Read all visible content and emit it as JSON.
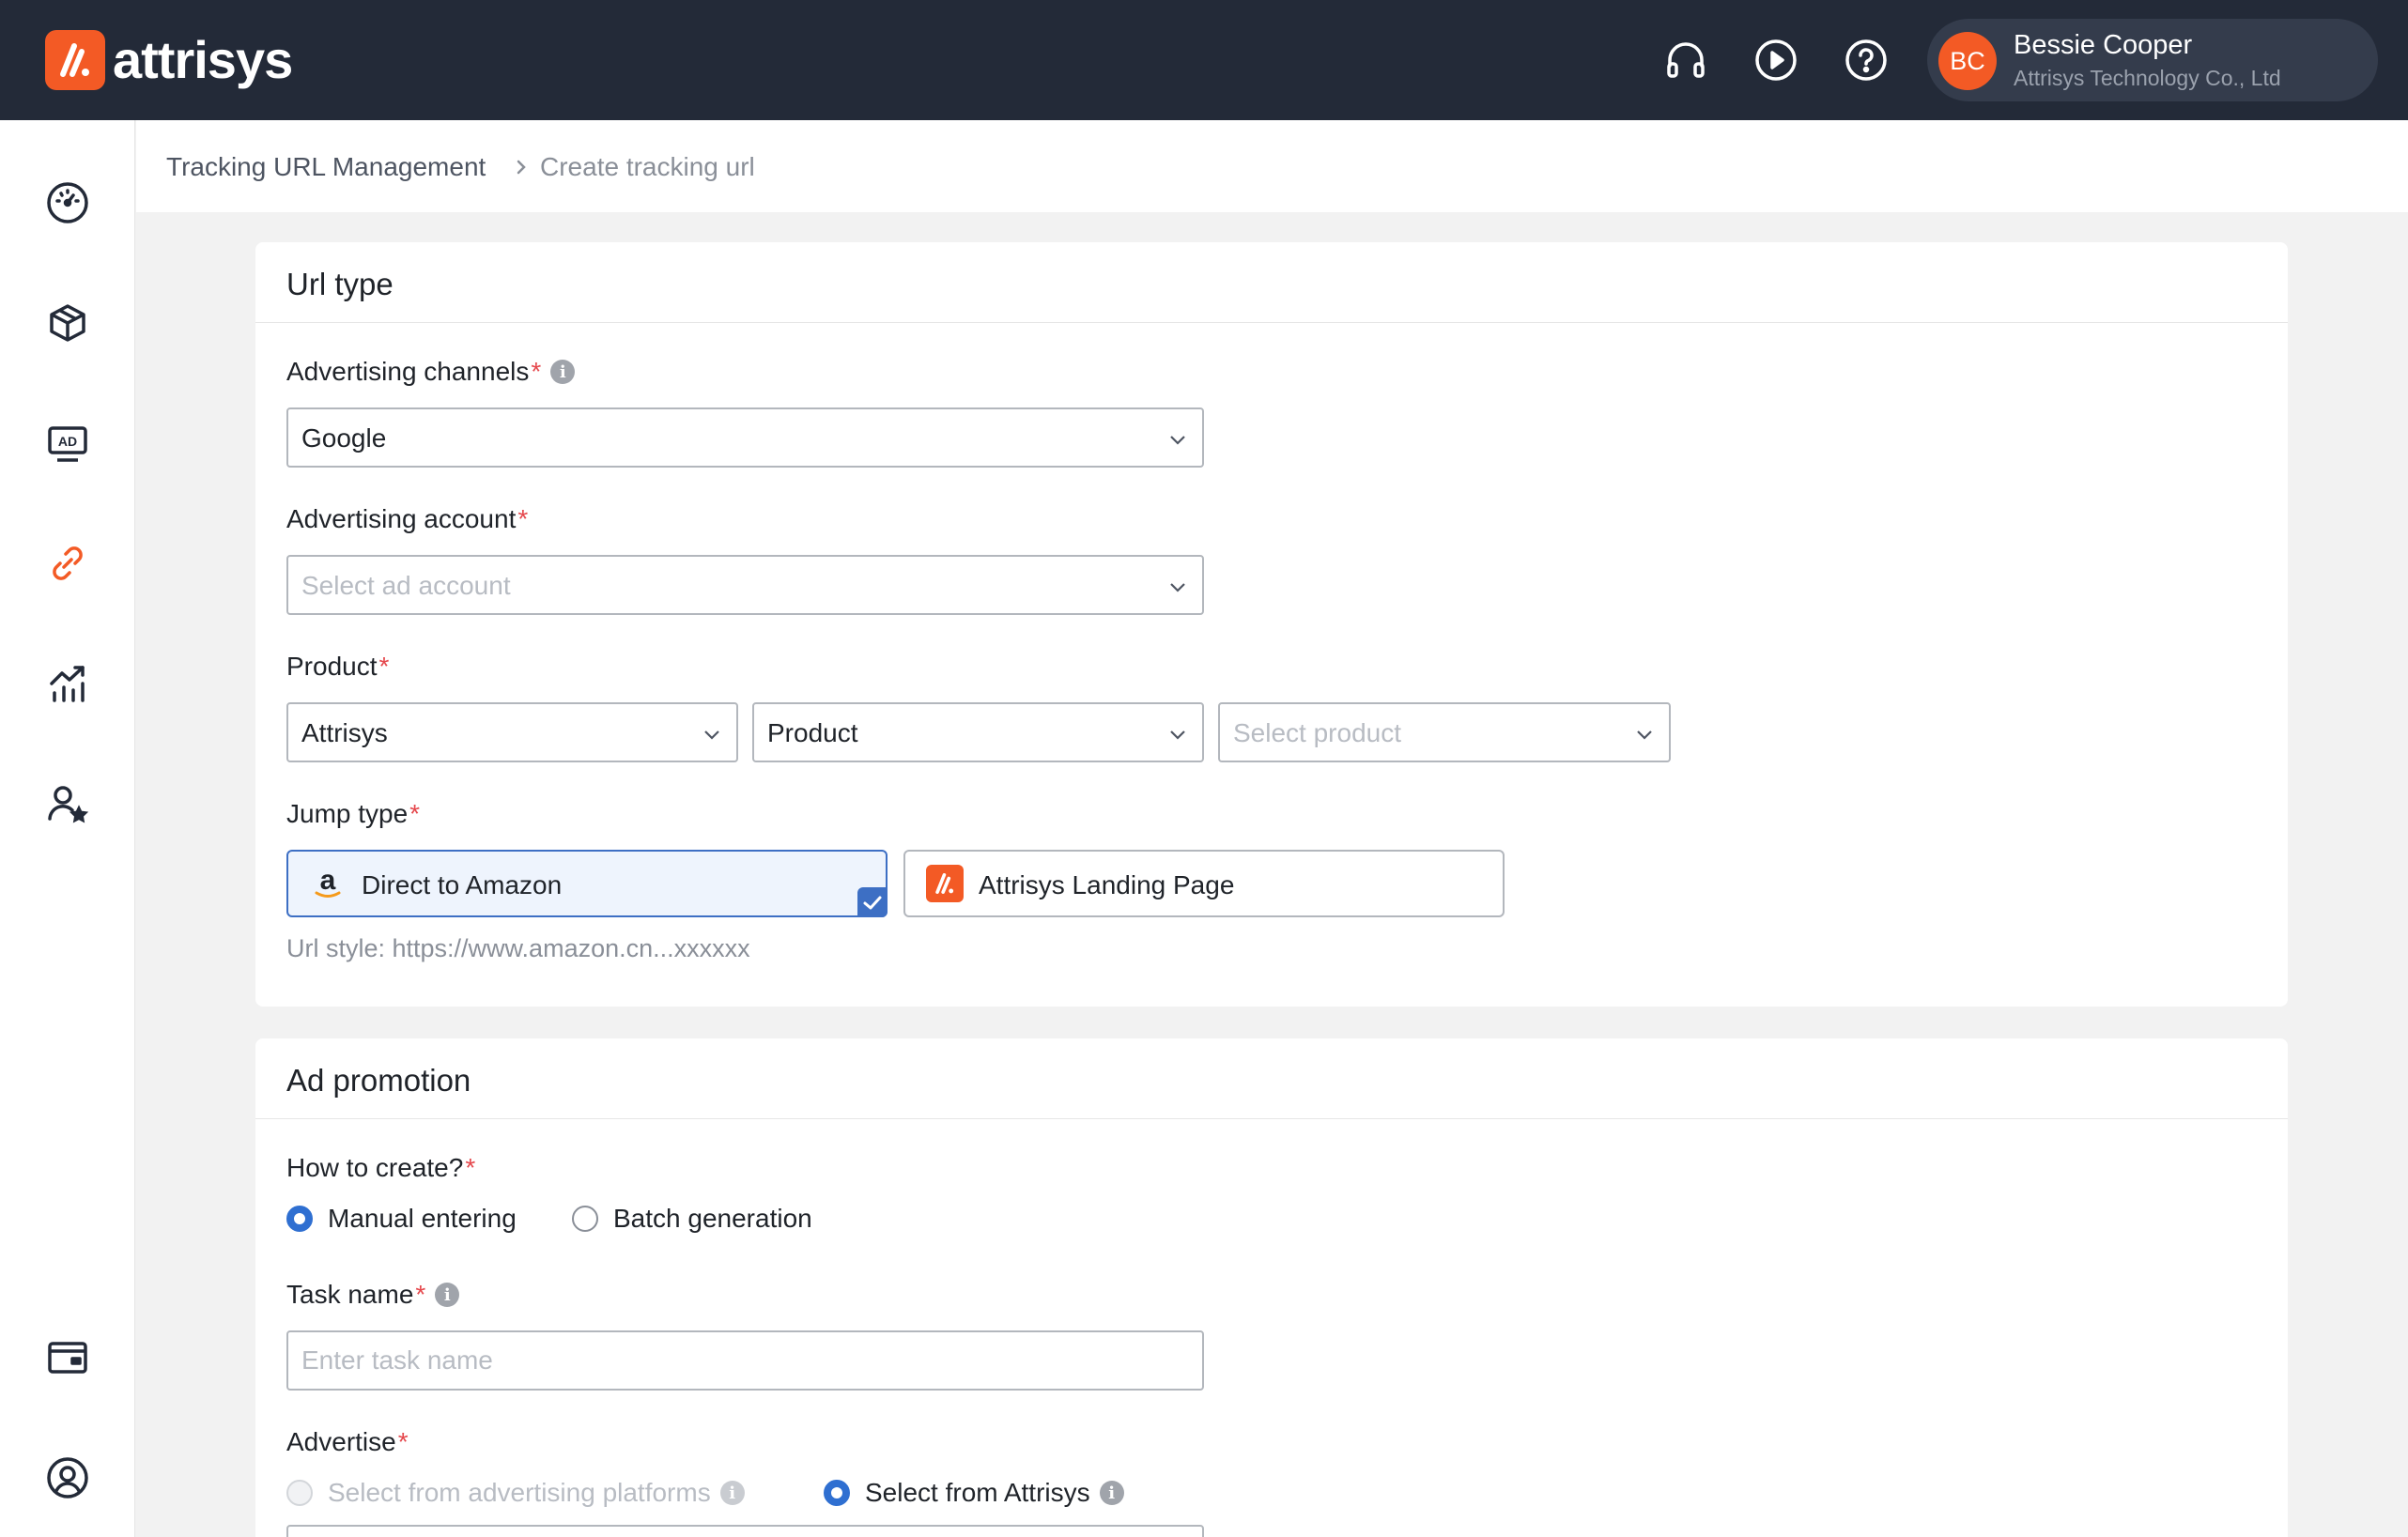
{
  "brand": {
    "name": "attrisys",
    "accent": "#f35a25",
    "topbar_bg": "#232a38"
  },
  "user": {
    "initials": "BC",
    "name": "Bessie Cooper",
    "org": "Attrisys Technology Co., Ltd"
  },
  "breadcrumb": {
    "parent": "Tracking URL Management",
    "separator": ">",
    "current": "Create tracking url"
  },
  "url_type": {
    "title": "Url type",
    "channels": {
      "label": "Advertising channels",
      "value": "Google"
    },
    "account": {
      "label": "Advertising account",
      "placeholder": "Select ad account"
    },
    "product": {
      "label": "Product",
      "brand_value": "Attrisys",
      "type_value": "Product",
      "product_placeholder": "Select product"
    },
    "jump": {
      "label": "Jump type",
      "options": [
        "Direct to Amazon",
        "Attrisys Landing Page"
      ],
      "selected": "Direct to Amazon",
      "hint": "Url style: https://www.amazon.cn...xxxxxx"
    }
  },
  "ad_promotion": {
    "title": "Ad promotion",
    "how": {
      "label": "How to create?",
      "options": [
        "Manual entering",
        "Batch generation"
      ],
      "selected": "Manual entering"
    },
    "task": {
      "label": "Task name",
      "placeholder": "Enter task name"
    },
    "advertise": {
      "label": "Advertise",
      "options": [
        "Select from advertising platforms",
        "Select from Attrisys"
      ],
      "selected": "Select from Attrisys"
    }
  }
}
